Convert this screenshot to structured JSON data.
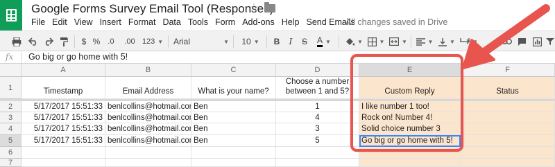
{
  "app": {
    "title": "Google Forms Survey Email Tool (Responses)",
    "save_status": "All changes saved in Drive",
    "accent": "#0f9d58"
  },
  "menu": [
    "File",
    "Edit",
    "View",
    "Insert",
    "Format",
    "Data",
    "Tools",
    "Form",
    "Add-ons",
    "Help",
    "Send Emails"
  ],
  "toolbar": {
    "zoom_options": {
      "percent_label": "%",
      "decimal_dec": ".0",
      "decimal_inc": ".00",
      "more_formats": "123"
    },
    "font_name": "Arial",
    "font_size": "10",
    "bold": "B",
    "italic": "I",
    "strike": "S",
    "text_color": "A"
  },
  "formula_bar": {
    "fx_label": "fx",
    "value": "Go big or go home with 5!"
  },
  "grid": {
    "columns": [
      "A",
      "B",
      "C",
      "D",
      "E",
      "F"
    ],
    "row_numbers": [
      "1",
      "2",
      "3",
      "4",
      "5",
      "6",
      "7"
    ],
    "headers": [
      "Timestamp",
      "Email Address",
      "What is your name?",
      "Choose a number between 1 and 5?",
      "Custom Reply",
      "Status"
    ],
    "rows": [
      [
        "5/17/2017 15:51:33",
        "benlcollins@hotmail.com",
        "Ben",
        "1",
        "I like number 1 too!",
        ""
      ],
      [
        "5/17/2017 15:51:33",
        "benlcollins@hotmail.com",
        "Ben",
        "4",
        "Rock on! Number 4!",
        ""
      ],
      [
        "5/17/2017 15:51:33",
        "benlcollins@hotmail.com",
        "Ben",
        "3",
        "Solid choice number 3",
        ""
      ],
      [
        "5/17/2017 15:51:33",
        "benlcollins@hotmail.com",
        "Ben",
        "5",
        "Go big or go home with 5!",
        ""
      ]
    ],
    "highlight_fill": "#fce5cd",
    "annotation_color": "#e8554e"
  }
}
